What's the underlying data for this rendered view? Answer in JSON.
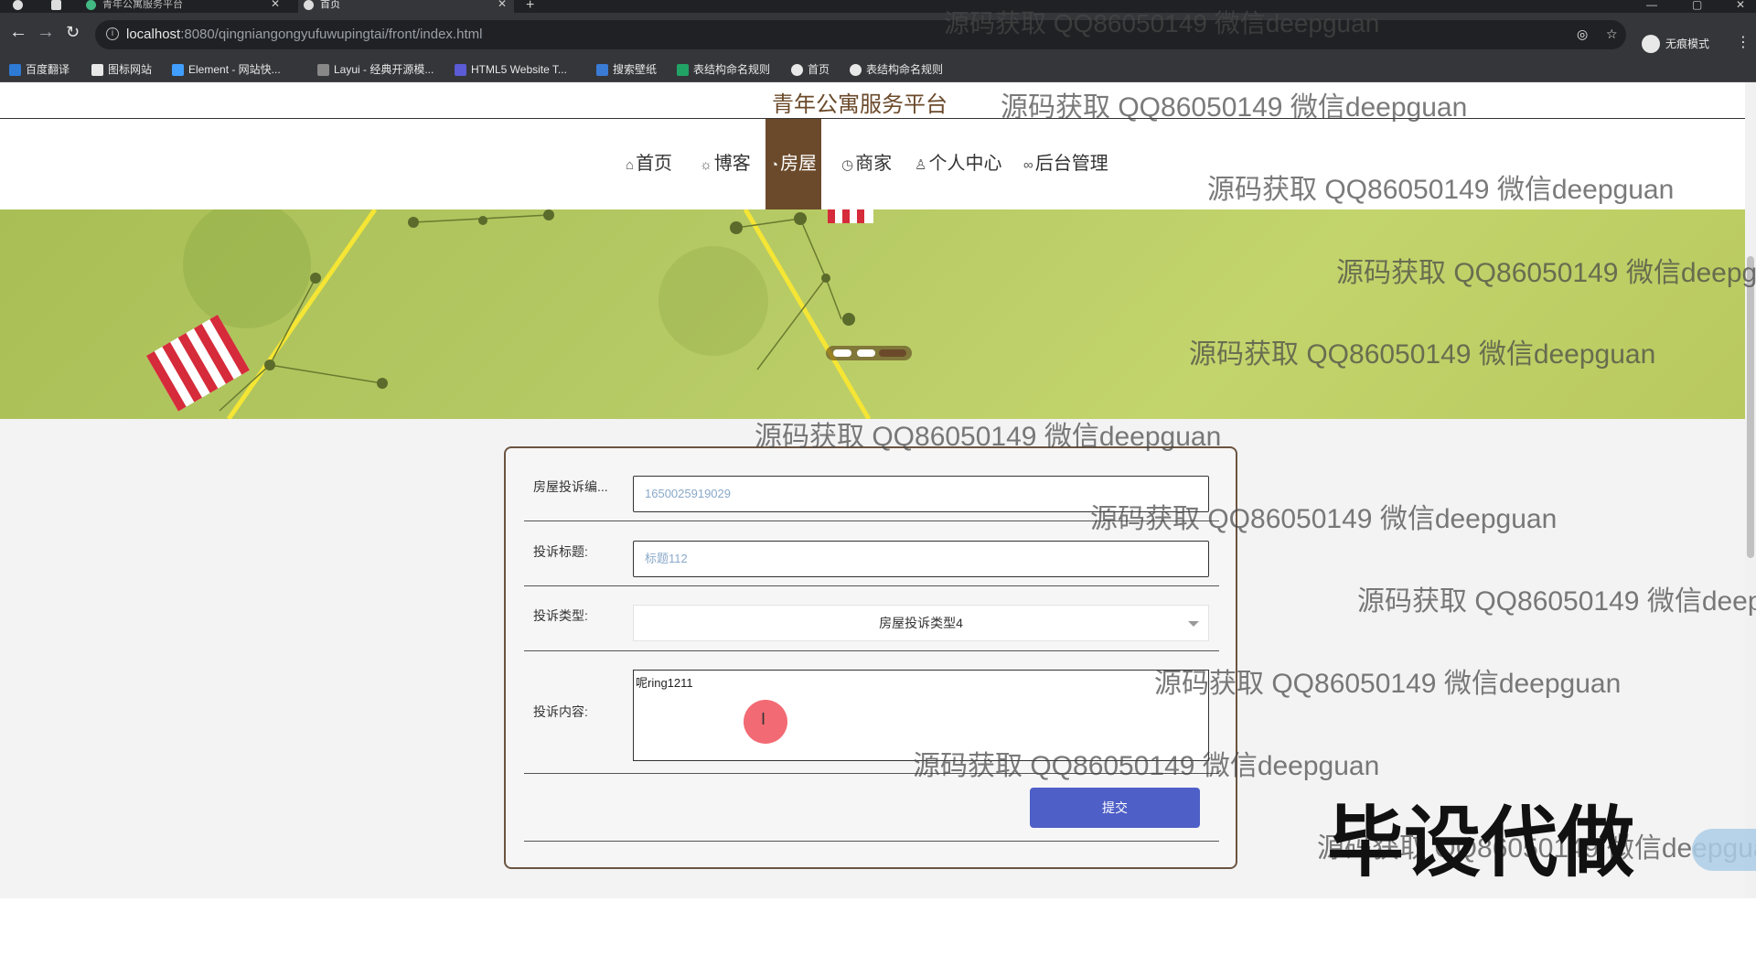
{
  "browser": {
    "tabs": [
      {
        "title": "青年公寓服务平台",
        "active": false
      },
      {
        "title": "首页",
        "active": true
      }
    ],
    "url_host": "localhost",
    "url_path": ":8080/qingniangongyufuwupingtai/front/index.html",
    "profile_label": "无痕模式",
    "bookmarks": [
      "百度翻译",
      "图标网站",
      "Element - 网站快...",
      "Layui - 经典开源模...",
      "HTML5 Website T...",
      "搜索壁纸",
      "表结构命名规则",
      "首页",
      "表结构命名规则"
    ]
  },
  "site": {
    "title": "青年公寓服务平台",
    "nav": [
      {
        "label": "首页",
        "icon": "home-icon",
        "active": false
      },
      {
        "label": "博客",
        "icon": "settings-icon",
        "active": false
      },
      {
        "label": "房屋",
        "icon": "house-icon",
        "active": true
      },
      {
        "label": "商家",
        "icon": "clock-icon",
        "active": false
      },
      {
        "label": "个人中心",
        "icon": "user-icon",
        "active": false
      },
      {
        "label": "后台管理",
        "icon": "link-icon",
        "active": false
      }
    ]
  },
  "form": {
    "complaint_no_label": "房屋投诉编...",
    "complaint_no_value": "1650025919029",
    "title_label": "投诉标题:",
    "title_value": "标题112",
    "type_label": "投诉类型:",
    "type_value": "房屋投诉类型4",
    "content_label": "投诉内容:",
    "content_value": "呢ring1211",
    "submit_label": "提交"
  },
  "watermark": {
    "text": "源码获取 QQ86050149 微信deepguan",
    "big_text": "毕设代做"
  },
  "colors": {
    "brand_brown": "#6b4a2b",
    "submit_blue": "#4e5fc7"
  }
}
